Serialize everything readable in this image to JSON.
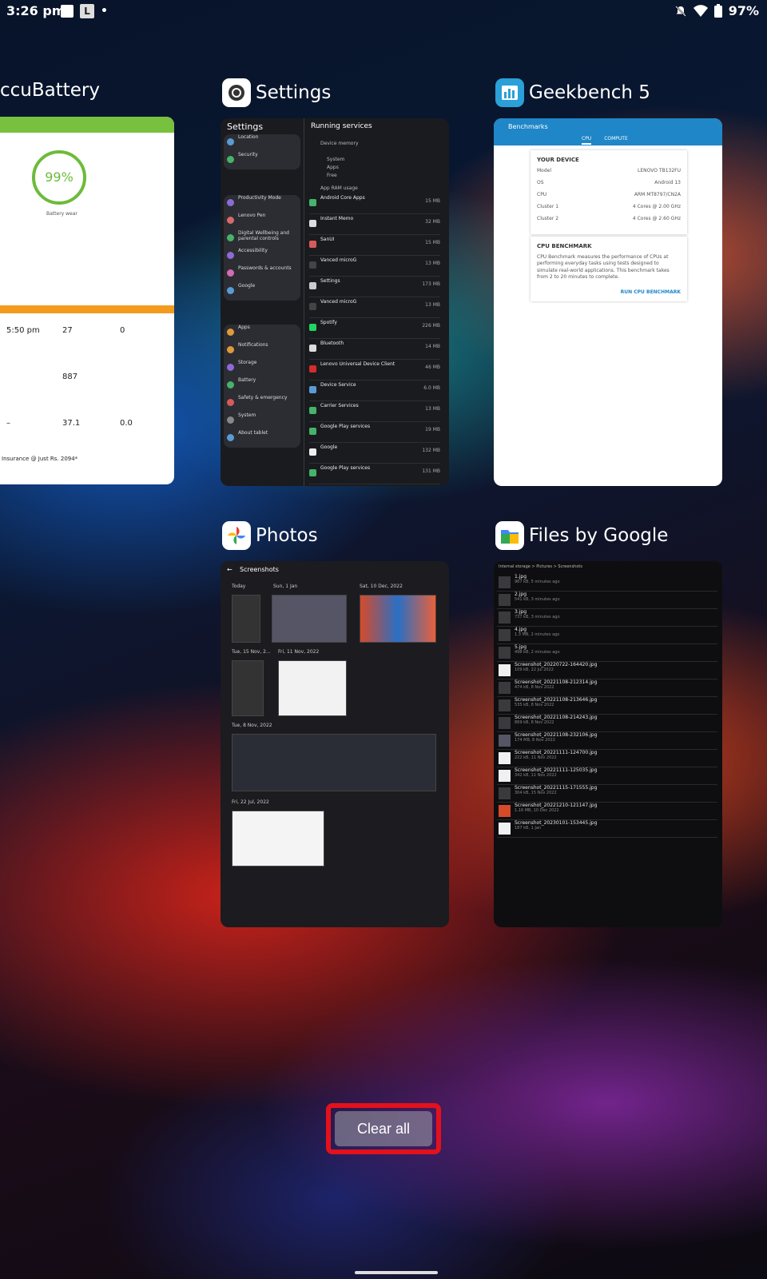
{
  "status": {
    "time": "3:26 pm",
    "notif_letter": "L",
    "notif_dot": "•",
    "battery": "97%"
  },
  "cards": {
    "accubattery": {
      "title": "ccuBattery",
      "percent": "99%",
      "battery_wear": "Battery wear",
      "charging": "5:50 pm",
      "screen_on": "27",
      "screen_off": "0",
      "efficiency": "887",
      "screen_on2": "37.1",
      "screen_off2": "0.0",
      "dash": "–",
      "ad": "Insurance @ Just Rs. 2094*"
    },
    "settings": {
      "title": "Settings",
      "left_title": "Settings",
      "groups": [
        [
          "Location",
          "Security"
        ],
        [
          "Productivity Mode",
          "Lenovo Pen",
          "Digital Wellbeing and parental controls",
          "Accessibility",
          "Passwords & accounts",
          "Google"
        ],
        [
          "Apps",
          "Notifications",
          "Storage",
          "Battery",
          "Safety & emergency",
          "System",
          "About tablet"
        ]
      ],
      "right_title": "Running services",
      "device_memory": "Device memory",
      "system": "System",
      "apps": "Apps",
      "free": "Free",
      "app_ram": "App RAM usage",
      "services": [
        {
          "name": "Android Core Apps",
          "size": "15 MB"
        },
        {
          "name": "Instant Memo",
          "size": "32 MB"
        },
        {
          "name": "SanUI",
          "size": "15 MB"
        },
        {
          "name": "Vanced microG",
          "size": "13 MB"
        },
        {
          "name": "Settings",
          "size": "173 MB"
        },
        {
          "name": "Vanced microG",
          "size": "13 MB"
        },
        {
          "name": "Spotify",
          "size": "226 MB"
        },
        {
          "name": "Bluetooth",
          "size": "14 MB"
        },
        {
          "name": "Lenovo Universal Device Client",
          "size": "46 MB"
        },
        {
          "name": "Device Service",
          "size": "6.0 MB"
        },
        {
          "name": "Carrier Services",
          "size": "13 MB"
        },
        {
          "name": "Google Play services",
          "size": "19 MB"
        },
        {
          "name": "Google",
          "size": "132 MB"
        },
        {
          "name": "Google Play services",
          "size": "131 MB"
        }
      ]
    },
    "geekbench": {
      "title": "Geekbench 5",
      "bar_title": "Benchmarks",
      "tab_cpu": "CPU",
      "tab_compute": "COMPUTE",
      "your_device": "YOUR DEVICE",
      "rows": [
        {
          "k": "Model",
          "v": "LENOVO TB132FU"
        },
        {
          "k": "OS",
          "v": "Android 13"
        },
        {
          "k": "CPU",
          "v": "ARM MT8797/CN2A"
        },
        {
          "k": "Cluster 1",
          "v": "4 Cores @ 2.00 GHz"
        },
        {
          "k": "Cluster 2",
          "v": "4 Cores @ 2.60 GHz"
        }
      ],
      "cpu_bench": "CPU BENCHMARK",
      "desc": "CPU Benchmark measures the performance of CPUs at performing everyday tasks using tests designed to simulate real-world applications. This benchmark takes from 2 to 20 minutes to complete.",
      "run": "RUN CPU BENCHMARK"
    },
    "photos": {
      "title": "Photos",
      "header": "Screenshots",
      "today": "Today",
      "d1": "Sun, 1 Jan",
      "d2": "Sat, 10 Dec, 2022",
      "d3": "Tue, 15 Nov, 2...",
      "d4": "Fri, 11 Nov, 2022",
      "d5": "Tue, 8 Nov, 2022",
      "d6": "Fri, 22 Jul, 2022"
    },
    "files": {
      "title": "Files by Google",
      "breadcrumb": "Internal storage  >  Pictures  >  Screenshots",
      "items": [
        {
          "name": "1.jpg",
          "meta": "967 kB, 5 minutes ago"
        },
        {
          "name": "2.jpg",
          "meta": "541 kB, 3 minutes ago"
        },
        {
          "name": "3.jpg",
          "meta": "737 kB, 3 minutes ago"
        },
        {
          "name": "4.jpg",
          "meta": "1.3 MB, 2 minutes ago"
        },
        {
          "name": "5.jpg",
          "meta": "498 kB, 2 minutes ago"
        },
        {
          "name": "Screenshot_20220722-164420.jpg",
          "meta": "109 kB, 22 Jul 2022"
        },
        {
          "name": "Screenshot_20221108-212314.jpg",
          "meta": "474 kB, 8 Nov 2022"
        },
        {
          "name": "Screenshot_20221108-213646.jpg",
          "meta": "535 kB, 8 Nov 2022"
        },
        {
          "name": "Screenshot_20221108-214243.jpg",
          "meta": "869 kB, 8 Nov 2022"
        },
        {
          "name": "Screenshot_20221108-232106.jpg",
          "meta": "174 MB, 8 Nov 2022"
        },
        {
          "name": "Screenshot_20221111-124700.jpg",
          "meta": "222 kB, 11 Nov 2022"
        },
        {
          "name": "Screenshot_20221111-125035.jpg",
          "meta": "342 kB, 11 Nov 2022"
        },
        {
          "name": "Screenshot_20221115-171555.jpg",
          "meta": "304 kB, 15 Nov 2022"
        },
        {
          "name": "Screenshot_20221210-121147.jpg",
          "meta": "1.16 MB, 10 Dec 2022"
        },
        {
          "name": "Screenshot_20230101-153445.jpg",
          "meta": "187 kB, 1 Jan"
        }
      ]
    }
  },
  "clear_all": "Clear all"
}
